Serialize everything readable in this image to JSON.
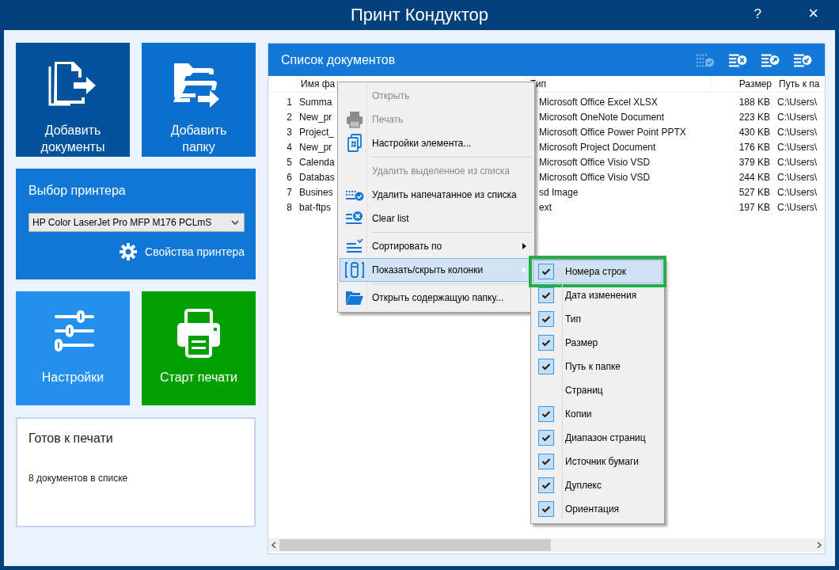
{
  "window": {
    "title": "Принт Кондуктор",
    "help": "?",
    "close": "×"
  },
  "tiles": [
    {
      "kind": "add-documents",
      "label": "Добавить документы"
    },
    {
      "kind": "add-folder",
      "label": "Добавить папку"
    }
  ],
  "printer": {
    "title": "Выбор принтера",
    "selected_printer": "HP Color LaserJet Pro MFP M176 PCLmS",
    "properties_link": "Свойства принтера"
  },
  "action_tiles": [
    {
      "kind": "settings",
      "label": "Настройки"
    },
    {
      "kind": "print",
      "label": "Старт печати"
    }
  ],
  "status": {
    "title": "Готов к печати",
    "message": "8 документов в списке"
  },
  "documents": {
    "title": "Список документов",
    "toolbar": [
      {
        "kind": "remove-printed",
        "disabled": true
      },
      {
        "kind": "clear",
        "disabled": false
      },
      {
        "kind": "export",
        "disabled": false
      },
      {
        "kind": "import",
        "disabled": false
      }
    ],
    "columns": [
      "Имя фа",
      "Тип",
      "Размер",
      "Путь к па"
    ],
    "rows": [
      {
        "number": "1",
        "name": "Summa",
        "type": "Microsoft Office Excel XLSX",
        "size": "188 KB",
        "path": "C:\\Users\\"
      },
      {
        "number": "2",
        "name": "New_pr",
        "type": "Microsoft OneNote Document",
        "size": "223 KB",
        "path": "C:\\Users\\"
      },
      {
        "number": "3",
        "name": "Project_",
        "type": "Microsoft Office Power Point PPTX",
        "size": "430 KB",
        "path": "C:\\Users\\"
      },
      {
        "number": "4",
        "name": "New_pr",
        "type": "Microsoft Project Document",
        "size": "176 KB",
        "path": "C:\\Users\\"
      },
      {
        "number": "5",
        "name": "Calenda",
        "type": "Microsoft Office Visio VSD",
        "size": "379 KB",
        "path": "C:\\Users\\"
      },
      {
        "number": "6",
        "name": "Databas",
        "type": "Microsoft Office Visio VSD",
        "size": "244 KB",
        "path": "C:\\Users\\"
      },
      {
        "number": "7",
        "name": "Busines",
        "type": "sd Image",
        "size": "527 KB",
        "path": "C:\\Users\\"
      },
      {
        "number": "8",
        "name": "bat-ftps",
        "type": "ext",
        "size": "197 KB",
        "path": "C:\\Users\\"
      }
    ]
  },
  "context_menu": {
    "groups": [
      [
        {
          "label": "Открыть",
          "kind": "none",
          "disabled": true,
          "submenu": false,
          "selected": false
        },
        {
          "label": "Печать",
          "kind": "printer",
          "disabled": true,
          "submenu": false,
          "selected": false
        },
        {
          "label": "Настройки элемента...",
          "kind": "doc-hash",
          "disabled": false,
          "submenu": false,
          "selected": false
        }
      ],
      [
        {
          "label": "Удалить выделенное из списка",
          "kind": "none",
          "disabled": true,
          "submenu": false,
          "selected": false
        },
        {
          "label": "Удалить напечатанное из списка",
          "kind": "remove-printed",
          "disabled": false,
          "submenu": false,
          "selected": false
        },
        {
          "label": "Clear list",
          "kind": "clear",
          "disabled": false,
          "submenu": false,
          "selected": false
        }
      ],
      [
        {
          "label": "Сортировать по",
          "kind": "sort",
          "disabled": false,
          "submenu": true,
          "selected": false
        },
        {
          "label": "Показать/скрыть колонки",
          "kind": "columns",
          "disabled": false,
          "submenu": true,
          "selected": true
        }
      ],
      [
        {
          "label": "Открыть содержащую папку...",
          "kind": "folder",
          "disabled": false,
          "submenu": false,
          "selected": false
        }
      ]
    ]
  },
  "columns_submenu": {
    "items": [
      {
        "label": "Номера строк",
        "checked": true,
        "selected": true
      },
      {
        "label": "Дата изменения",
        "checked": true,
        "selected": false
      },
      {
        "label": "Тип",
        "checked": true,
        "selected": false
      },
      {
        "label": "Размер",
        "checked": true,
        "selected": false
      },
      {
        "label": "Путь к папке",
        "checked": true,
        "selected": false
      },
      {
        "label": "Страниц",
        "checked": false,
        "selected": false
      },
      {
        "label": "Копии",
        "checked": true,
        "selected": false
      },
      {
        "label": "Диапазон страниц",
        "checked": true,
        "selected": false
      },
      {
        "label": "Источник бумаги",
        "checked": true,
        "selected": false
      },
      {
        "label": "Дуплекс",
        "checked": true,
        "selected": false
      },
      {
        "label": "Ориентация",
        "checked": true,
        "selected": false
      }
    ]
  }
}
